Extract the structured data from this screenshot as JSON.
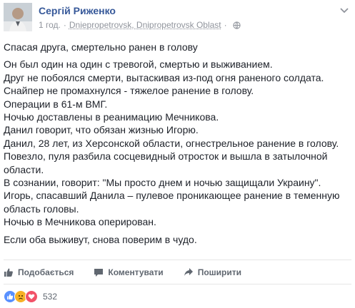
{
  "post": {
    "author": "Сергій Риженко",
    "time": "1 год.",
    "separator": "·",
    "location": "Dniepropetrovsk, Dnipropetrovsk Oblast",
    "title": "Спасая друга, смертельно ранен в голову",
    "lines": [
      "Он был один на один с тревогой, смертью и выживанием.",
      "Друг не побоялся смерти, вытаскивая из-под огня раненого солдата.",
      "Снайпер не промахнулся - тяжелое ранение в голову.",
      "Операции в 61-м ВМГ.",
      "Ночью доставлены в реанимацию Мечникова.",
      "Данил говорит, что обязан жизнью Игорю.",
      "Данил, 28 лет, из Херсонской области, огнестрельное ранение в голову.",
      "Повезло, пуля разбила сосцевидный отросток и вышла в затылочной",
      "области.",
      "В сознании, говорит: \"Мы просто днем и ночью защищали Украину\".",
      "Игорь, спасавший Данила – пулевое проникающее ранение в теменную",
      "область головы.",
      "Ночью в Мечникова оперирован."
    ],
    "closing": "Если оба выживут, снова поверим в чудо."
  },
  "actions": {
    "like": "Подобається",
    "comment": "Коментувати",
    "share": "Поширити"
  },
  "reactions": {
    "count": "532",
    "types": [
      "like-icon",
      "sad-icon",
      "love-icon"
    ],
    "colors": {
      "like": "#5890ff",
      "sad": "#f7b125",
      "love": "#f25268"
    }
  },
  "colors": {
    "link": "#365899",
    "meta": "#90949c",
    "text": "#1d2129",
    "action": "#606770"
  }
}
